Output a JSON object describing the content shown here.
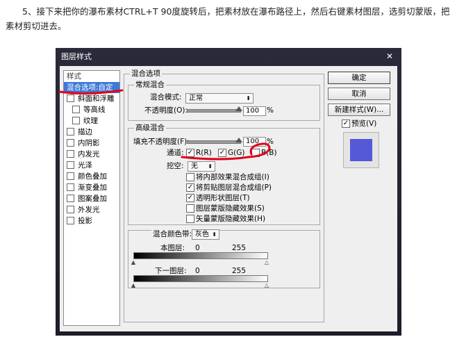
{
  "caption": "5、接下来把你的瀑布素材CTRL+T 90度旋转后，把素材放在瀑布路径上，然后右键素材图层，选剪切蒙版，把素材剪切进去。",
  "dialog": {
    "title": "图层样式",
    "close": "✕"
  },
  "styles": {
    "header": "样式",
    "items": [
      {
        "label": "混合选项:自定",
        "selected": true
      },
      {
        "label": "斜面和浮雕"
      },
      {
        "label": "等高线",
        "sub": true
      },
      {
        "label": "纹理",
        "sub": true
      },
      {
        "label": "描边"
      },
      {
        "label": "内阴影"
      },
      {
        "label": "内发光"
      },
      {
        "label": "光泽"
      },
      {
        "label": "颜色叠加"
      },
      {
        "label": "渐变叠加"
      },
      {
        "label": "图案叠加"
      },
      {
        "label": "外发光"
      },
      {
        "label": "投影"
      }
    ]
  },
  "blend": {
    "section": "混合选项",
    "general": {
      "title": "常规混合",
      "mode_label": "混合模式:",
      "mode_value": "正常",
      "opacity_label": "不透明度(O):",
      "opacity_value": "100",
      "percent": "%"
    },
    "advanced": {
      "title": "高级混合",
      "fill_label": "填充不透明度(F):",
      "fill_value": "100",
      "percent": "%",
      "channels_label": "通道:",
      "channel_r": "R(R)",
      "channel_g": "G(G)",
      "channel_b": "B(B)",
      "knockout_label": "挖空:",
      "knockout_value": "无",
      "options": [
        {
          "label": "将内部效果混合成组(I)",
          "checked": false
        },
        {
          "label": "将剪贴图层混合成组(P)",
          "checked": true
        },
        {
          "label": "透明形状图层(T)",
          "checked": true
        },
        {
          "label": "图层蒙版隐藏效果(S)",
          "checked": false
        },
        {
          "label": "矢量蒙版隐藏效果(H)",
          "checked": false
        }
      ]
    },
    "blend_if": {
      "label": "混合颜色带:",
      "value": "灰色",
      "this_layer": "本图层:",
      "underlying": "下一图层:",
      "min": "0",
      "max": "255"
    }
  },
  "buttons": {
    "ok": "确定",
    "cancel": "取消",
    "new_style": "新建样式(W)...",
    "preview": "预览(V)"
  },
  "colors": {
    "selection": "#3f78d6",
    "swatch": "#5459d8",
    "annotation_red": "#e0001b"
  }
}
